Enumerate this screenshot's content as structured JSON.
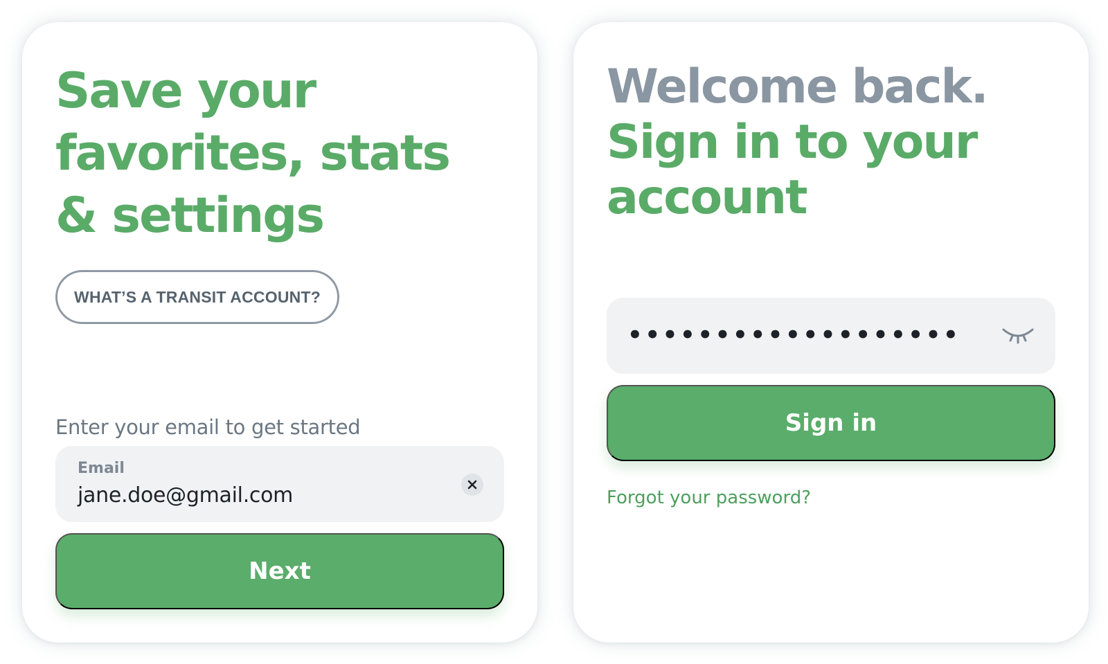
{
  "colors": {
    "brand_green": "#5aab68",
    "muted_gray": "#8a96a2",
    "field_bg": "#f1f2f4",
    "button_green": "#5aad6a"
  },
  "email_card": {
    "headline": "Save your favorites, stats & settings",
    "info_button": "WHAT’S A TRANSIT ACCOUNT?",
    "prompt": "Enter your email to get started",
    "email_label": "Email",
    "email_value": "jane.doe@gmail.com",
    "clear_icon": "clear-x-icon",
    "next_button": "Next"
  },
  "password_card": {
    "welcome": "Welcome back.",
    "title": "Sign in to your account",
    "password_masked": "•••••••••••••••••••",
    "show_password_icon": "eye-closed-icon",
    "signin_button": "Sign in",
    "forgot_link": "Forgot your password?"
  }
}
